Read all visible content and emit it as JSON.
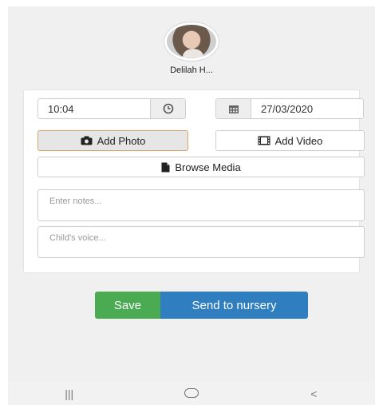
{
  "profile": {
    "name": "Delilah H..."
  },
  "time": {
    "value": "10:04",
    "icon": "clock-icon"
  },
  "date": {
    "value": "27/03/2020",
    "icon": "calendar-icon"
  },
  "media": {
    "add_photo": "Add Photo",
    "add_video": "Add Video",
    "browse": "Browse Media"
  },
  "notes": {
    "placeholder": "Enter notes..."
  },
  "voice": {
    "placeholder": "Child's voice..."
  },
  "actions": {
    "save": "Save",
    "send": "Send to nursery"
  },
  "colors": {
    "save": "#4aab53",
    "send": "#2f7fc0",
    "active_border": "#d9a66a"
  },
  "navbar": {
    "recents": "|||",
    "back": "<"
  }
}
